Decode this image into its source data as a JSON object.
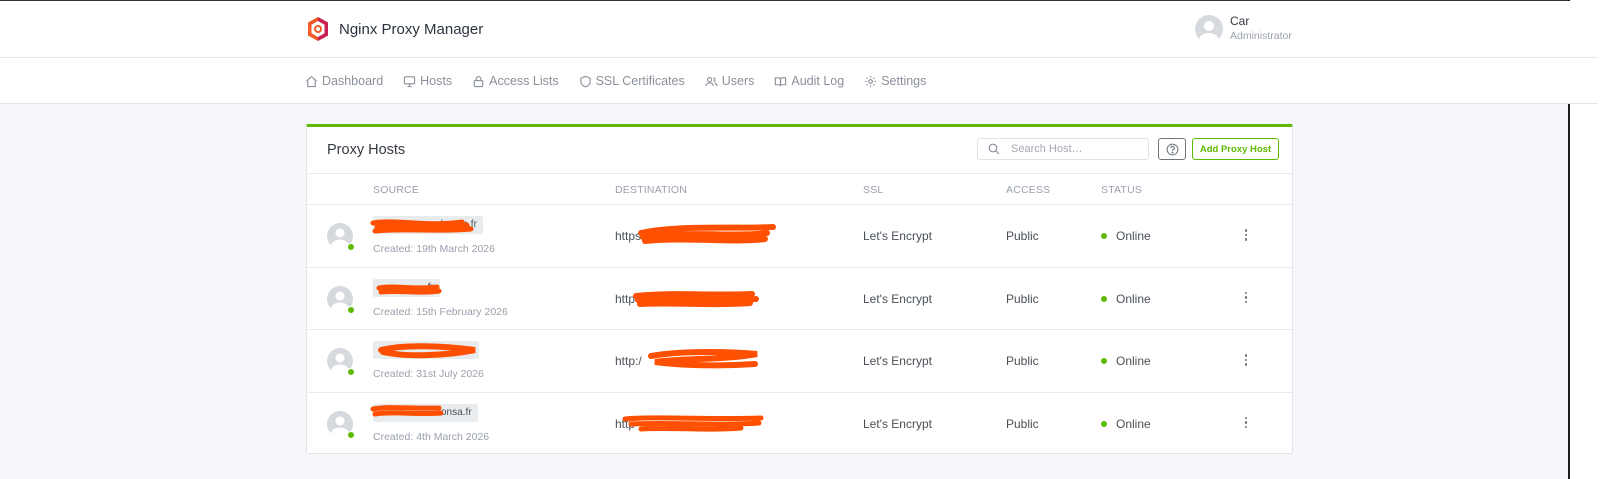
{
  "app": {
    "title": "Nginx Proxy Manager"
  },
  "user": {
    "name": "Car",
    "role": "Administrator"
  },
  "nav": [
    {
      "label": "Dashboard",
      "icon": "home-icon"
    },
    {
      "label": "Hosts",
      "icon": "monitor-icon"
    },
    {
      "label": "Access Lists",
      "icon": "lock-icon"
    },
    {
      "label": "SSL Certificates",
      "icon": "shield-icon"
    },
    {
      "label": "Users",
      "icon": "users-icon"
    },
    {
      "label": "Audit Log",
      "icon": "book-icon"
    },
    {
      "label": "Settings",
      "icon": "gear-icon"
    }
  ],
  "card": {
    "title": "Proxy Hosts",
    "search_placeholder": "Search Host…",
    "add_label": "Add Proxy Host"
  },
  "table": {
    "headers": [
      "SOURCE",
      "DESTINATION",
      "SSL",
      "ACCESS",
      "STATUS"
    ],
    "rows": [
      {
        "source": "ıshonsa.fr",
        "created": "Created: 19th March 2026",
        "destination": "https:/",
        "ssl": "Let's Encrypt",
        "access": "Public",
        "status": "Online"
      },
      {
        "source": ".fr",
        "created": "Created: 15th February 2026",
        "destination": "http",
        "ssl": "Let's Encrypt",
        "access": "Public",
        "status": "Online"
      },
      {
        "source": "",
        "created": "Created: 31st July 2026",
        "destination": "http:/",
        "ssl": "Let's Encrypt",
        "access": "Public",
        "status": "Online"
      },
      {
        "source": "onsa.fr",
        "created": "Created: 4th March 2026",
        "destination": "http",
        "ssl": "Let's Encrypt",
        "access": "Public",
        "status": "Online"
      }
    ]
  },
  "colors": {
    "accent": "#5eba00",
    "redaction": "#ff4f00"
  }
}
